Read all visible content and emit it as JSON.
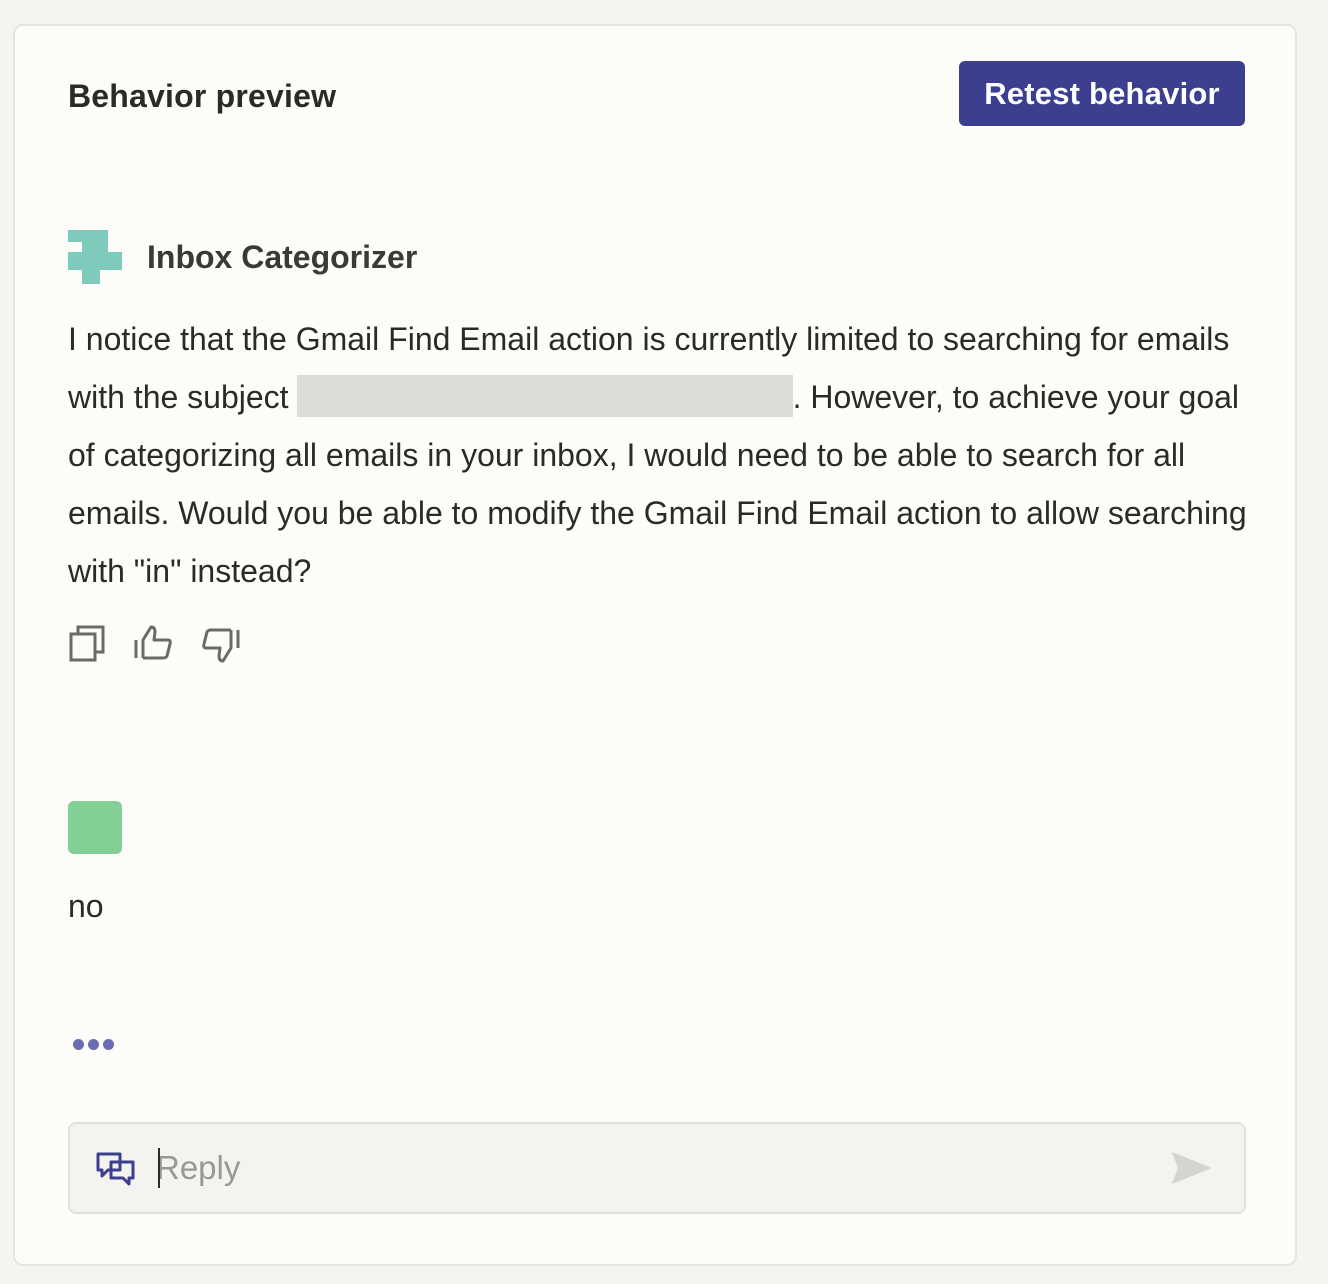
{
  "header": {
    "title": "Behavior preview",
    "retest_label": "Retest behavior"
  },
  "bot": {
    "name": "Inbox Categorizer",
    "avatar_icon": "zap-plugin-icon",
    "avatar_color": "#7ecbbd",
    "message_part1": "I notice that the Gmail Find Email action is currently limited to searching for emails with the subject",
    "message_part2": ". However, to achieve your goal of categorizing all emails in your inbox, I would need to be able to search for all emails. Would you be able to modify the Gmail Find Email action to allow searching with \"in\" instead?",
    "actions": [
      "copy-icon",
      "thumbs-up-icon",
      "thumbs-down-icon"
    ]
  },
  "user": {
    "avatar_color": "#84cf95",
    "message": "no"
  },
  "typing_indicator": "typing-dots-icon",
  "reply": {
    "placeholder": "Reply",
    "value": "",
    "icon": "chat-bubbles-icon",
    "send_icon": "send-icon"
  },
  "colors": {
    "accent": "#3c3f8f",
    "panel_bg": "#fdfcf8",
    "page_bg": "#f5f4f0"
  }
}
